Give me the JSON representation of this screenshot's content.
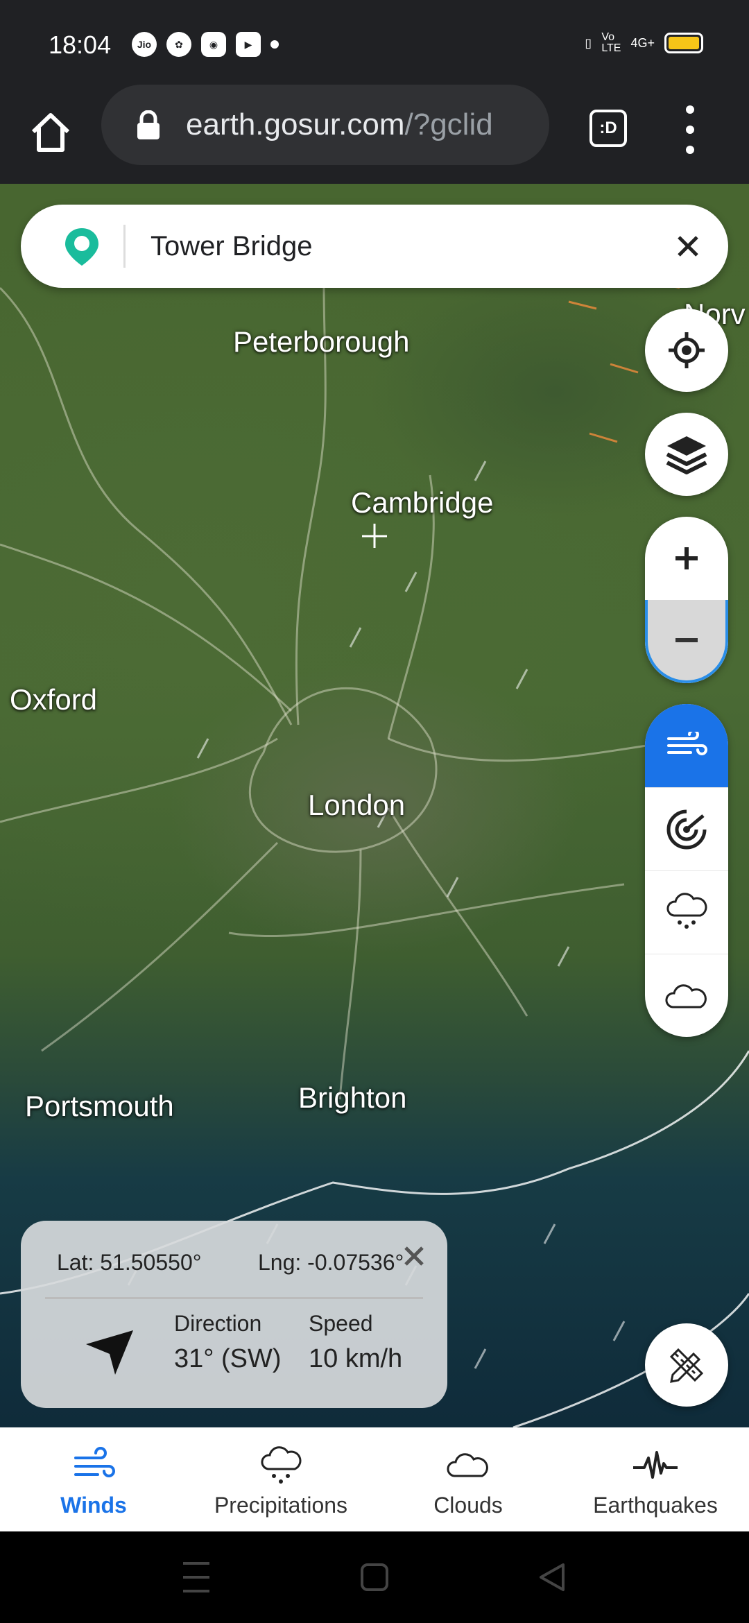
{
  "status_bar": {
    "time": "18:04",
    "left_icons": [
      "jio-icon",
      "app-icon",
      "gamepad-icon",
      "youtube-icon",
      "dot"
    ],
    "right_text": "4G+"
  },
  "browser": {
    "url_domain": "earth.gosur.com",
    "url_path": "/?gclid",
    "tab_label": ":D"
  },
  "search": {
    "value": "Tower Bridge"
  },
  "map": {
    "cities": [
      "Peterborough",
      "Cambridge",
      "Oxford",
      "London",
      "Portsmouth",
      "Brighton",
      "Norv"
    ]
  },
  "info_card": {
    "lat": "Lat: 51.50550°",
    "lng": "Lng: -0.07536°",
    "direction_label": "Direction",
    "direction_value": "31° (SW)",
    "speed_label": "Speed",
    "speed_value": "10 km/h"
  },
  "bottom_nav": {
    "items": [
      {
        "label": "Winds",
        "icon": "wind-icon",
        "active": true
      },
      {
        "label": "Precipitations",
        "icon": "rain-cloud-icon",
        "active": false
      },
      {
        "label": "Clouds",
        "icon": "cloud-icon",
        "active": false
      },
      {
        "label": "Earthquakes",
        "icon": "seismograph-icon",
        "active": false
      }
    ]
  },
  "colors": {
    "accent": "#1a73e8",
    "chrome_bg": "#202124"
  }
}
